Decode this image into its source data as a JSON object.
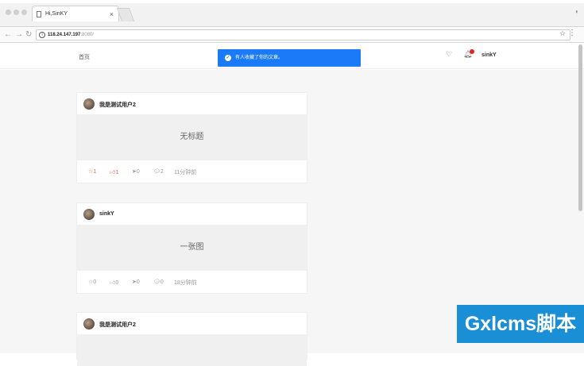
{
  "browser": {
    "tab_title": "Hi,SinKY",
    "tab_close": "×",
    "url_host": "118.24.147.197",
    "url_path": ":8080/",
    "star_glyph": "☆",
    "menu_glyph": "⋮"
  },
  "header": {
    "home_label": "首页",
    "username": "sinkY",
    "toast_text": "有人收藏了你的文章。",
    "toast_color": "#1a7af8",
    "notification_dot_color": "#e8221f"
  },
  "posts": [
    {
      "author": "我是测试用户2",
      "title": "无标题",
      "stars": "1",
      "likes": "1",
      "shares": "0",
      "comments": "2",
      "time": "11分钟前",
      "starred": true,
      "liked": true
    },
    {
      "author": "sinkY",
      "title": "一张图",
      "stars": "0",
      "likes": "0",
      "shares": "0",
      "comments": "0",
      "time": "18分钟前",
      "starred": false,
      "liked": false
    },
    {
      "author": "我是测试用户2"
    }
  ],
  "watermark": "Gxlcms脚本"
}
